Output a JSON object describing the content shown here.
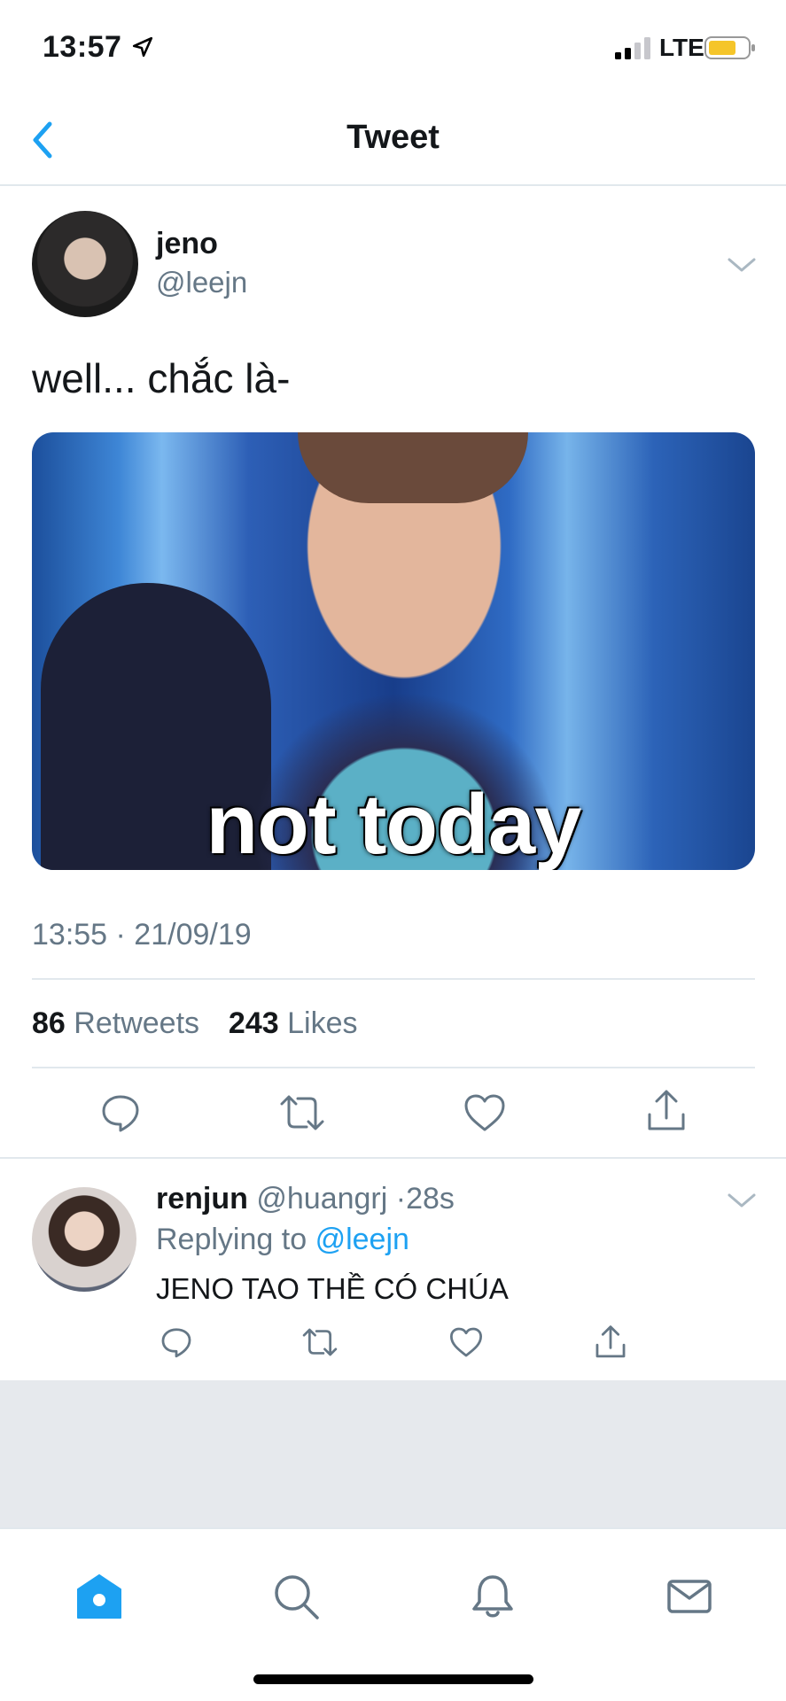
{
  "status_bar": {
    "time": "13:57",
    "network": "LTE",
    "icons": [
      "location-arrow-icon",
      "signal-icon",
      "battery-icon"
    ]
  },
  "nav": {
    "title": "Tweet",
    "back_icon": "chevron-left-icon"
  },
  "tweet": {
    "author_name": "jeno",
    "author_handle": "@leejn",
    "text": "well... chắc là-",
    "media_caption": "not today",
    "timestamp": "13:55 · 21/09/19",
    "retweets_count": "86",
    "retweets_label": "Retweets",
    "likes_count": "243",
    "likes_label": "Likes",
    "actions": [
      "reply-icon",
      "retweet-icon",
      "like-icon",
      "share-icon"
    ]
  },
  "reply": {
    "author_name": "renjun",
    "author_handle": "@huangrj",
    "separator": "·",
    "time_ago": "28s",
    "replying_to_label": "Replying to",
    "replying_to_handle": "@leejn",
    "text": "JENO TAO THỀ CÓ CHÚA"
  },
  "tab_bar": {
    "tabs": [
      "home-icon",
      "search-icon",
      "notifications-icon",
      "messages-icon"
    ],
    "active": "home-icon"
  },
  "colors": {
    "accent": "#1da1f2",
    "secondary_text": "#657786",
    "divider": "#e1e8ed",
    "icon": "#657786",
    "battery_fill": "#f5c52a"
  }
}
